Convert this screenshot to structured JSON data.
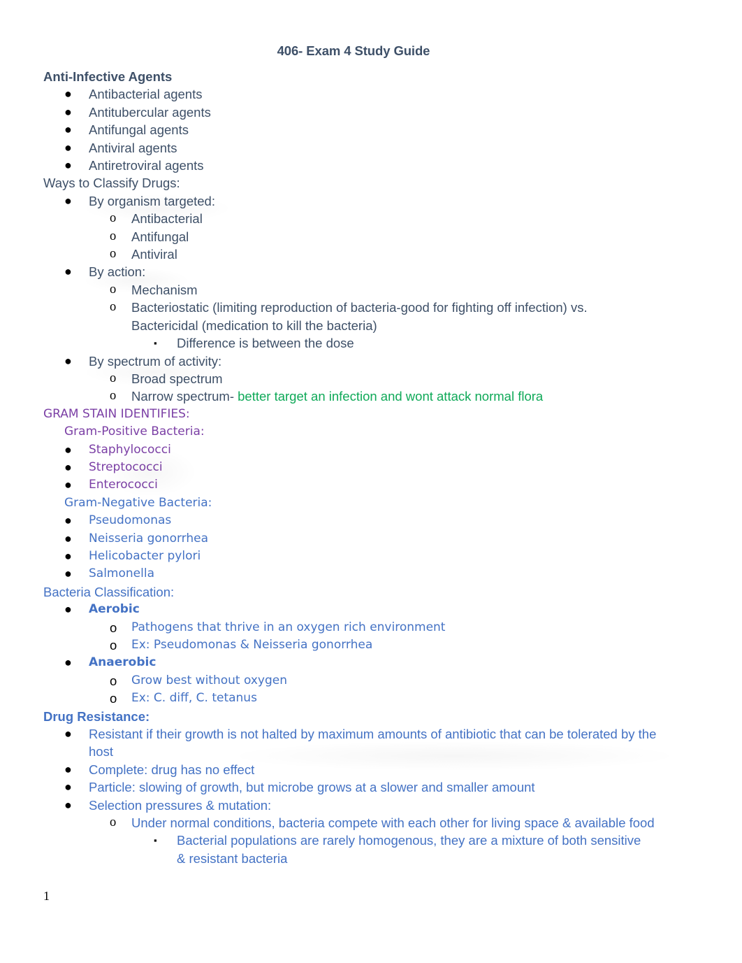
{
  "document": {
    "title": "406- Exam 4 Study Guide",
    "page_number": "1"
  },
  "sections": {
    "anti_infective": {
      "heading": "Anti-Infective Agents",
      "items": [
        "Antibacterial agents",
        "Antitubercular agents",
        "Antifungal agents",
        "Antiviral agents",
        "Antiretroviral agents"
      ]
    },
    "classify": {
      "heading": "Ways to Classify Drugs:",
      "by_organism": {
        "label": "By organism targeted:",
        "items": [
          "Antibacterial",
          "Antifungal",
          "Antiviral"
        ]
      },
      "by_action": {
        "label": "By action:",
        "mechanism": "Mechanism",
        "bacteriostatic": "Bacteriostatic (limiting reproduction of bacteria-good for fighting off infection) vs. Bactericidal (medication to kill the bacteria)",
        "difference": "Difference is between the dose"
      },
      "by_spectrum": {
        "label": "By spectrum of activity:",
        "broad": "Broad spectrum",
        "narrow_prefix": "Narrow spectrum- ",
        "narrow_highlight": "better target an infection and wont attack normal flora"
      }
    },
    "gram_stain": {
      "heading": "GRAM STAIN IDENTIFIES:",
      "positive": {
        "label": "Gram-Positive Bacteria:",
        "items": [
          "Staphylococci",
          "Streptococci",
          "Enterococci"
        ]
      },
      "negative": {
        "label": "Gram-Negative Bacteria:",
        "items": [
          "Pseudomonas",
          "Neisseria gonorrhea",
          "Helicobacter pylori",
          "Salmonella"
        ]
      }
    },
    "bacteria_classification": {
      "heading": "Bacteria Classification:",
      "aerobic": {
        "label": "Aerobic",
        "items": [
          "Pathogens that thrive in an oxygen rich environment",
          "Ex: Pseudomonas & Neisseria gonorrhea"
        ]
      },
      "anaerobic": {
        "label": "Anaerobic",
        "items": [
          "Grow best without oxygen",
          "Ex: C. diff, C. tetanus"
        ]
      }
    },
    "drug_resistance": {
      "heading": "Drug Resistance:",
      "items": [
        "Resistant if their growth is not halted by maximum amounts of antibiotic that can be tolerated by the host",
        "Complete: drug has no effect",
        "Particle: slowing of growth, but microbe grows at a slower and smaller amount",
        "Selection pressures & mutation:"
      ],
      "selection_sub": "Under normal conditions, bacteria compete with each other for living space & available food",
      "selection_sub_sub": "Bacterial populations are rarely homogenous, they are a mixture of both sensitive & resistant bacteria"
    }
  },
  "markers": {
    "disc": "●",
    "circle": "o",
    "square": "▪"
  },
  "colors": {
    "body": "#3E5068",
    "green": "#0FA958",
    "purple": "#7B3FA5",
    "blue": "#4472C4",
    "black": "#000000"
  }
}
